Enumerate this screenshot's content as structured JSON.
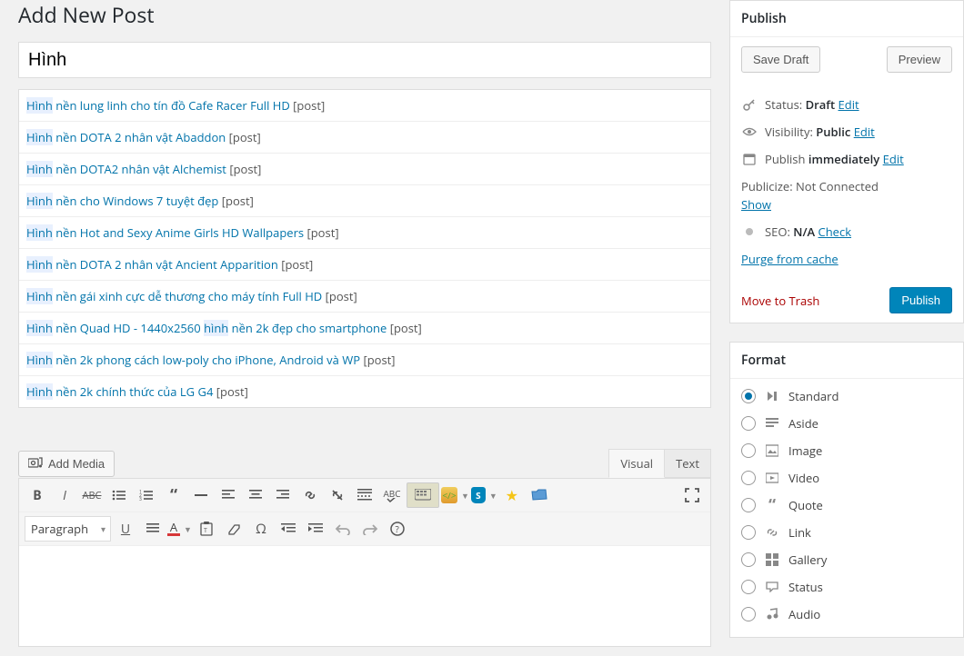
{
  "page_title": "Add New Post",
  "title_value": "Hình",
  "highlight": "Hình",
  "suggestions": [
    {
      "text": " nền lung linh cho tín đồ Cafe Racer Full HD",
      "suffix": " [post]"
    },
    {
      "text": " nền DOTA 2 nhân vật Abaddon",
      "suffix": " [post]"
    },
    {
      "text": " nền DOTA2 nhân vật Alchemist",
      "suffix": " [post]"
    },
    {
      "text": " nền cho Windows 7 tuyệt đẹp",
      "suffix": " [post]"
    },
    {
      "text": " nền Hot and Sexy Anime Girls HD Wallpapers",
      "suffix": " [post]"
    },
    {
      "text": " nền DOTA 2 nhân vật Ancient Apparition",
      "suffix": " [post]"
    },
    {
      "text": " nền gái xinh cực dễ thương cho máy tính Full HD",
      "suffix": " [post]"
    },
    {
      "text": " nền Quad HD - 1440x2560 hình nền 2k đẹp cho smartphone",
      "suffix": " [post]",
      "second_highlight_at": 25
    },
    {
      "text": " nền 2k phong cách low-poly cho iPhone, Android và WP",
      "suffix": " [post]"
    },
    {
      "text": " nền 2k chính thức của LG G4",
      "suffix": " [post]"
    }
  ],
  "add_media": "Add Media",
  "tabs": {
    "visual": "Visual",
    "text": "Text"
  },
  "paragraph": "Paragraph",
  "publish": {
    "heading": "Publish",
    "save_draft": "Save Draft",
    "preview": "Preview",
    "status_label": "Status: ",
    "status_value": "Draft",
    "visibility_label": "Visibility: ",
    "visibility_value": "Public",
    "publish_label": "Publish ",
    "publish_value": "immediately",
    "publicize": "Publicize: Not Connected",
    "show": "Show",
    "seo_label": "SEO: ",
    "seo_value": "N/A",
    "check": "Check",
    "purge": "Purge from cache",
    "trash": "Move to Trash",
    "publish_btn": "Publish",
    "edit": "Edit"
  },
  "format": {
    "heading": "Format",
    "items": [
      {
        "label": "Standard",
        "checked": true
      },
      {
        "label": "Aside",
        "checked": false
      },
      {
        "label": "Image",
        "checked": false
      },
      {
        "label": "Video",
        "checked": false
      },
      {
        "label": "Quote",
        "checked": false
      },
      {
        "label": "Link",
        "checked": false
      },
      {
        "label": "Gallery",
        "checked": false
      },
      {
        "label": "Status",
        "checked": false
      },
      {
        "label": "Audio",
        "checked": false
      }
    ]
  }
}
